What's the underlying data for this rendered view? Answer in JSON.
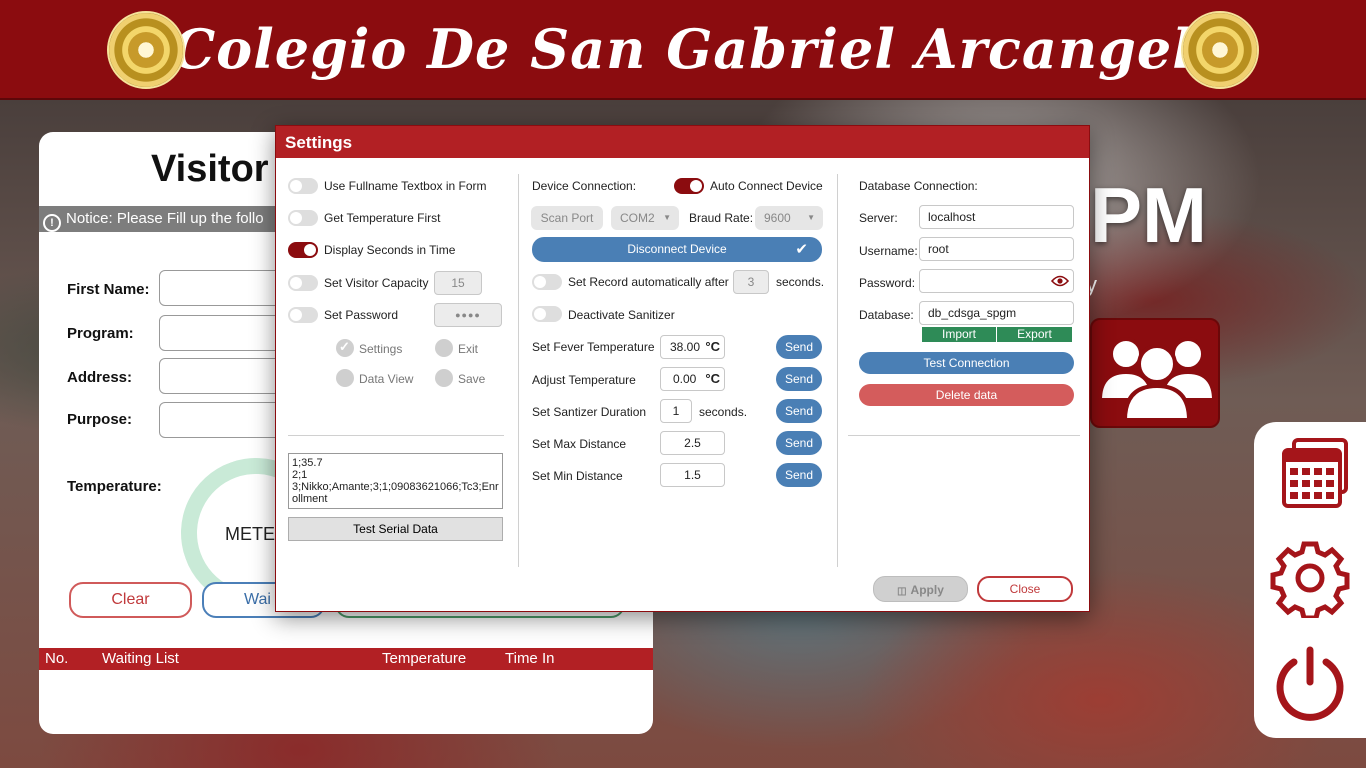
{
  "header": {
    "title": "Colegio De San Gabriel Arcangel"
  },
  "visitor": {
    "title": "Visitor",
    "notice": "Notice: Please Fill up the follo",
    "labels": {
      "first_name": "First Name:",
      "program": "Program:",
      "address": "Address:",
      "purpose": "Purpose:",
      "temperature": "Temperature:"
    },
    "meter_text": "METE",
    "clear_label": "Clear",
    "wait_label": "Wai",
    "list_headers": {
      "no": "No.",
      "waiting_list": "Waiting List",
      "temperature": "Temperature",
      "time_in": "Time In"
    }
  },
  "right": {
    "big_text": "PM",
    "small_text": "y"
  },
  "settings": {
    "title": "Settings",
    "left": {
      "toggles": [
        {
          "label": "Use Fullname Textbox in Form",
          "on": false
        },
        {
          "label": "Get Temperature First",
          "on": false
        },
        {
          "label": "Display Seconds in Time",
          "on": true
        },
        {
          "label": "Set Visitor Capacity",
          "on": false
        },
        {
          "label": "Set Password",
          "on": false
        }
      ],
      "visitor_capacity": "15",
      "password_mask": "●●●●",
      "checks": {
        "settings": "Settings",
        "exit": "Exit",
        "data_view": "Data View",
        "save": "Save"
      },
      "serial_text": "1;35.7\n2;1\n3;Nikko;Amante;3;1;09083621066;Tc3;Enrollment",
      "test_serial_label": "Test Serial Data"
    },
    "middle": {
      "device_connection_label": "Device Connection:",
      "auto_connect_label": "Auto Connect Device",
      "scan_port_label": "Scan Port",
      "com_port": "COM2",
      "baud_label": "Braud Rate:",
      "baud_rate": "9600",
      "disconnect_label": "Disconnect Device",
      "record_auto_label": "Set Record automatically after",
      "record_seconds": "3",
      "seconds_label": "seconds.",
      "deactivate_label": "Deactivate Sanitizer",
      "fever_label": "Set Fever Temperature",
      "fever_value": "38.00",
      "adjust_label": "Adjust Temperature",
      "adjust_value": "0.00",
      "celsius": "°C",
      "sanitizer_label": "Set Santizer Duration",
      "sanitizer_value": "1",
      "max_label": "Set Max Distance",
      "max_value": "2.5",
      "min_label": "Set Min Distance",
      "min_value": "1.5",
      "send_label": "Send"
    },
    "right": {
      "db_connection_label": "Database Connection:",
      "server_label": "Server:",
      "server_value": "localhost",
      "username_label": "Username:",
      "username_value": "root",
      "password_label": "Password:",
      "database_label": "Database:",
      "database_value": "db_cdsga_spgm",
      "import_label": "Import",
      "export_label": "Export",
      "test_connection_label": "Test Connection",
      "delete_data_label": "Delete data"
    },
    "apply_label": "Apply",
    "close_label": "Close"
  },
  "colors": {
    "brand_red": "#8b0c0f",
    "accent_blue": "#4a7fb5",
    "danger": "#c0393b",
    "success": "#2e8b57"
  }
}
